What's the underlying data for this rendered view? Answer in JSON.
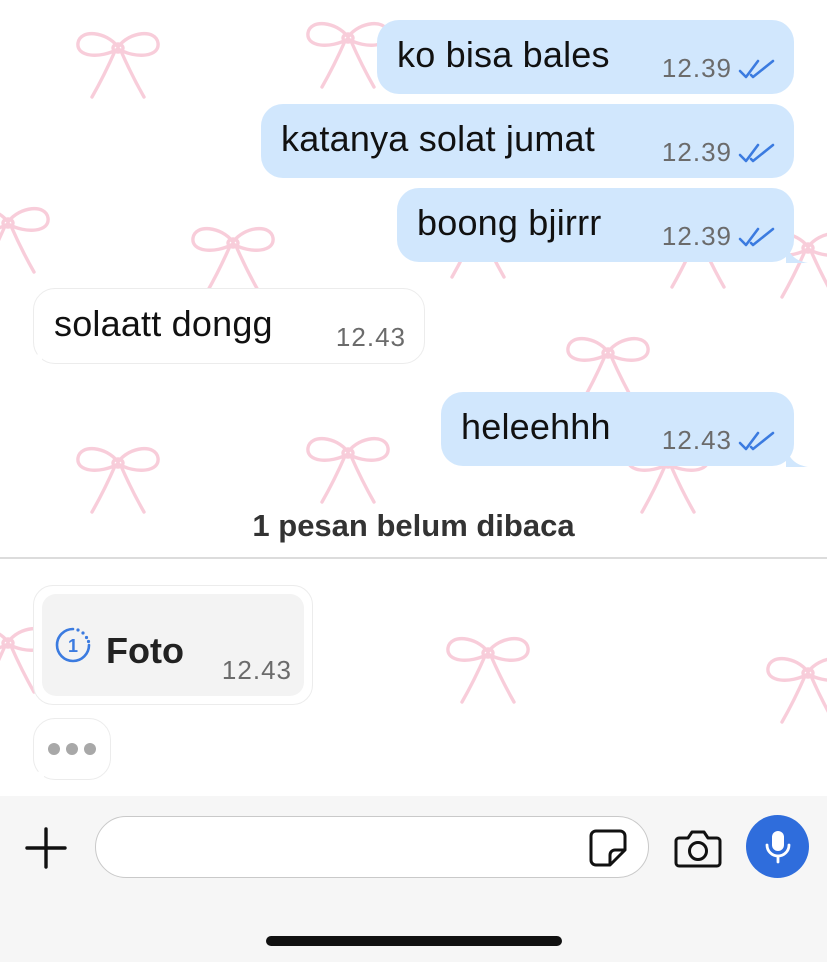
{
  "messages": [
    {
      "direction": "outgoing",
      "text": "ko bisa bales",
      "time": "12.39",
      "status_icon": "double-check-icon"
    },
    {
      "direction": "outgoing",
      "text": "katanya solat jumat",
      "time": "12.39",
      "status_icon": "double-check-icon"
    },
    {
      "direction": "outgoing",
      "text": "boong bjirrr",
      "time": "12.39",
      "status_icon": "double-check-icon"
    },
    {
      "direction": "incoming",
      "text": "solaatt dongg",
      "time": "12.43"
    },
    {
      "direction": "outgoing",
      "text": "heleehhh",
      "time": "12.43",
      "status_icon": "double-check-icon"
    }
  ],
  "unread_divider": "1 pesan belum dibaca",
  "view_once_photo": {
    "icon": "view-once-icon",
    "label": "Foto",
    "time": "12.43"
  },
  "typing_indicator": {
    "icon": "typing-dots-icon"
  },
  "input_bar": {
    "placeholder": "",
    "value": "",
    "icons": [
      "plus-icon",
      "sticker-icon",
      "camera-icon",
      "microphone-icon"
    ]
  },
  "background": {
    "pattern": "pink-bow-wallpaper",
    "bow_color": "#f4a6bd"
  },
  "colors": {
    "outgoing_bubble": "#d1e7fd",
    "incoming_bubble": "#ffffff",
    "read_tick": "#3b7be0",
    "mic_button": "#2f6ddc",
    "view_once_icon": "#3b7be0"
  }
}
